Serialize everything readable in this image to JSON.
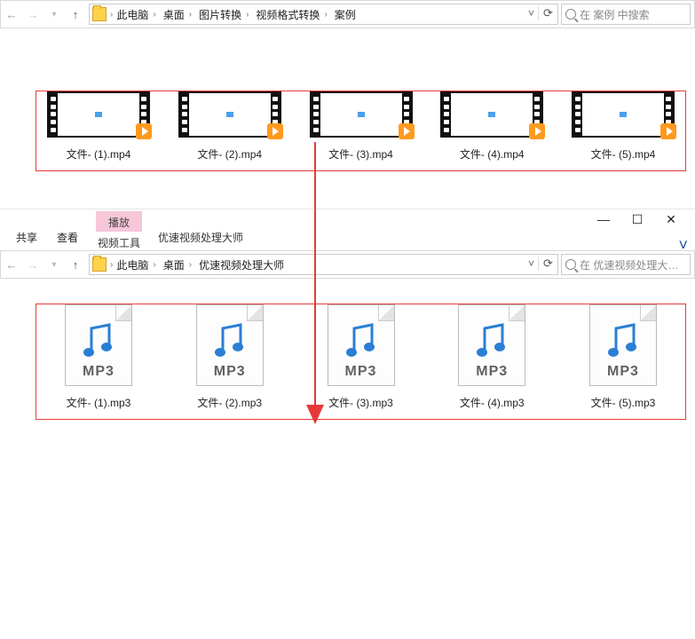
{
  "window1": {
    "breadcrumb": [
      "此电脑",
      "桌面",
      "图片转换",
      "视频格式转换",
      "案例"
    ],
    "search_placeholder": "在 案例 中搜索",
    "files": [
      {
        "name": "文件- (1).mp4"
      },
      {
        "name": "文件- (2).mp4"
      },
      {
        "name": "文件- (3).mp4"
      },
      {
        "name": "文件- (4).mp4"
      },
      {
        "name": "文件- (5).mp4"
      }
    ]
  },
  "window2": {
    "tab_share": "共享",
    "tab_view": "查看",
    "tab_play": "播放",
    "tab_play_sub": "视频工具",
    "title": "优速视频处理大师",
    "breadcrumb": [
      "此电脑",
      "桌面",
      "优速视频处理大师"
    ],
    "search_placeholder": "在 优速视频处理大…",
    "mp3_badge": "MP3",
    "files": [
      {
        "name": "文件- (1).mp3"
      },
      {
        "name": "文件- (2).mp3"
      },
      {
        "name": "文件- (3).mp3"
      },
      {
        "name": "文件- (4).mp3"
      },
      {
        "name": "文件- (5).mp3"
      }
    ]
  }
}
